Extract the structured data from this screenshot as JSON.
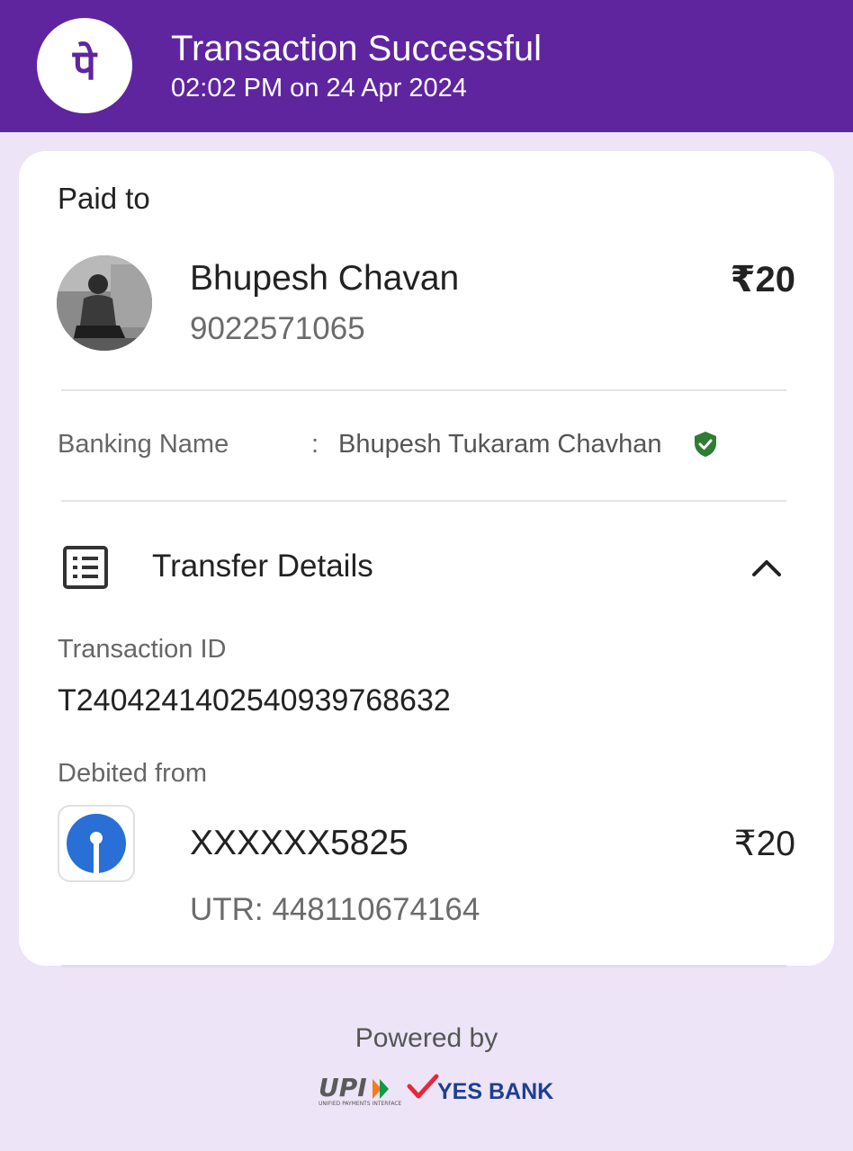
{
  "header": {
    "logo_letter": "पे",
    "title": "Transaction Successful",
    "subtitle": "02:02 PM on 24 Apr 2024",
    "background_color": "#5f259f"
  },
  "paid_to": {
    "label": "Paid to",
    "name": "Bhupesh Chavan",
    "phone": "9022571065",
    "amount": "₹20",
    "avatar_icon": "user-photo-avatar"
  },
  "banking": {
    "label": "Banking Name",
    "separator": ":",
    "value": "Bhupesh Tukaram Chavhan",
    "verified_icon": "verified-shield-icon",
    "verified_color": "#2e7d32"
  },
  "transfer_details": {
    "title": "Transfer Details",
    "icon": "receipt-list-icon",
    "toggle_icon": "chevron-up-icon",
    "transaction_id_label": "Transaction ID",
    "transaction_id": "T2404241402540939768632",
    "debited_from_label": "Debited from",
    "account": "XXXXXX5825",
    "amount": "₹20",
    "utr": "UTR: 448110674164",
    "bank_logo_icon": "sbi-logo-icon"
  },
  "footer": {
    "powered_by": "Powered by",
    "upi_text": "UPI",
    "upi_tagline": "UNIFIED PAYMENTS INTERFACE",
    "partner_bank": "YES BANK"
  }
}
